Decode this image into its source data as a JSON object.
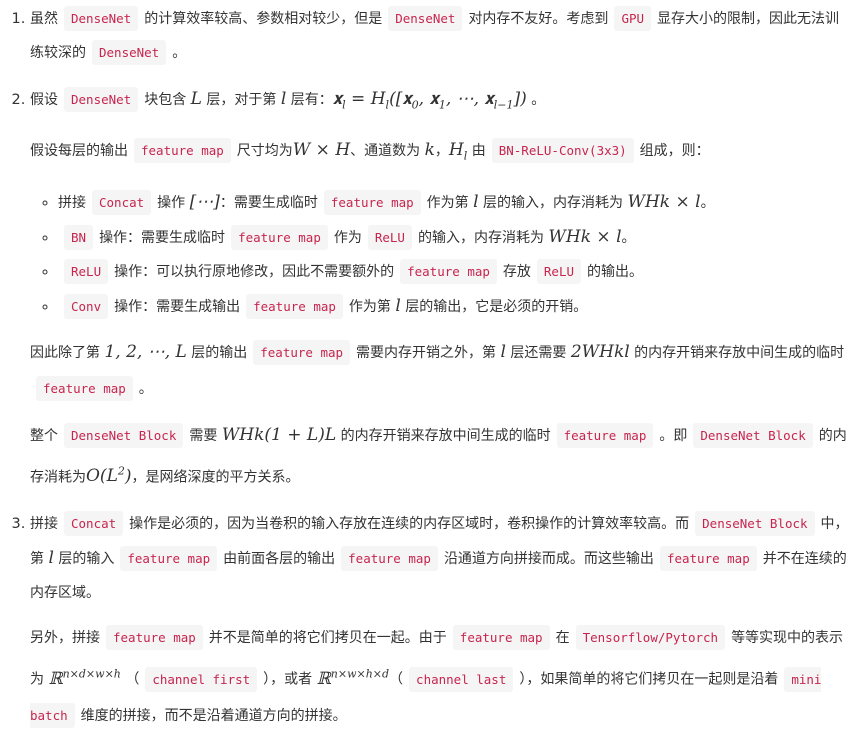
{
  "items": [
    {
      "paras": [
        [
          {
            "t": "虽然"
          },
          {
            "c": "DenseNet"
          },
          {
            "t": "的计算效率较高、参数相对较少，但是"
          },
          {
            "c": "DenseNet"
          },
          {
            "t": "对内存不友好。考虑到"
          },
          {
            "c": "GPU"
          },
          {
            "t": "显存大小的限制，因此无法训练较深的"
          },
          {
            "c": "DenseNet"
          },
          {
            "t": "。"
          }
        ]
      ],
      "bullets": [],
      "after": []
    },
    {
      "paras": [
        [
          {
            "t": "假设"
          },
          {
            "c": "DenseNet"
          },
          {
            "t": "块包含 "
          },
          {
            "m": "L"
          },
          {
            "t": " 层，对于第 "
          },
          {
            "m": "l"
          },
          {
            "t": " 层有："
          },
          {
            "m": "𝐱",
            "sub": "l"
          },
          {
            "m": " = H",
            "sub": "l"
          },
          {
            "m": "([𝐱",
            "sub": "0"
          },
          {
            "m": ", 𝐱",
            "sub": "1"
          },
          {
            "m": ", ⋯, 𝐱",
            "sub": "l−1"
          },
          {
            "m": "])"
          },
          {
            "t": " 。"
          }
        ],
        [
          {
            "t": "假设每层的输出"
          },
          {
            "c": "feature map"
          },
          {
            "t": "尺寸均为"
          },
          {
            "m": "W × H"
          },
          {
            "t": "、通道数为 "
          },
          {
            "m": "k"
          },
          {
            "t": "，"
          },
          {
            "m": "H",
            "sub": "l"
          },
          {
            "t": " 由"
          },
          {
            "c": "BN-ReLU-Conv(3x3)"
          },
          {
            "t": "组成，则："
          }
        ]
      ],
      "bullets": [
        [
          {
            "t": "拼接"
          },
          {
            "c": "Concat"
          },
          {
            "t": "操作 "
          },
          {
            "m": "[⋯]"
          },
          {
            "t": "：需要生成临时"
          },
          {
            "c": "feature map"
          },
          {
            "t": "作为第 "
          },
          {
            "m": "l"
          },
          {
            "t": " 层的输入，内存消耗为 "
          },
          {
            "m": "WHk × l"
          },
          {
            "t": "。"
          }
        ],
        [
          {
            "c": "BN"
          },
          {
            "t": "操作：需要生成临时"
          },
          {
            "c": "feature map"
          },
          {
            "t": "作为"
          },
          {
            "c": "ReLU"
          },
          {
            "t": "的输入，内存消耗为 "
          },
          {
            "m": "WHk × l"
          },
          {
            "t": "。"
          }
        ],
        [
          {
            "c": "ReLU"
          },
          {
            "t": "操作：可以执行原地修改，因此不需要额外的"
          },
          {
            "c": "feature map"
          },
          {
            "t": "存放"
          },
          {
            "c": "ReLU"
          },
          {
            "t": "的输出。"
          }
        ],
        [
          {
            "c": "Conv"
          },
          {
            "t": "操作：需要生成输出"
          },
          {
            "c": "feature map"
          },
          {
            "t": "作为第 "
          },
          {
            "m": "l"
          },
          {
            "t": " 层的输出，它是必须的开销。"
          }
        ]
      ],
      "after": [
        [
          {
            "t": "因此除了第 "
          },
          {
            "m": "1, 2, ⋯, L"
          },
          {
            "t": " 层的输出"
          },
          {
            "c": "feature map"
          },
          {
            "t": "需要内存开销之外，第 "
          },
          {
            "m": "l"
          },
          {
            "t": " 层还需要 "
          },
          {
            "m": "2WHkl"
          },
          {
            "t": " 的内存开销来存放中间生成的临时"
          },
          {
            "c": "feature map"
          },
          {
            "t": "。"
          }
        ],
        [
          {
            "t": "整个"
          },
          {
            "c": "DenseNet Block"
          },
          {
            "t": "需要 "
          },
          {
            "m": "WHk(1 + L)L"
          },
          {
            "t": " 的内存开销来存放中间生成的临时"
          },
          {
            "c": "feature map"
          },
          {
            "t": "。即"
          },
          {
            "c": "DenseNet Block"
          },
          {
            "t": "的内存消耗为"
          },
          {
            "m": "O(L",
            "sup": "2"
          },
          {
            "m": ")"
          },
          {
            "t": "，是网络深度的平方关系。"
          }
        ]
      ]
    },
    {
      "paras": [
        [
          {
            "t": "拼接"
          },
          {
            "c": "Concat"
          },
          {
            "t": "操作是必须的，因为当卷积的输入存放在连续的内存区域时，卷积操作的计算效率较高。而"
          },
          {
            "c": "DenseNet Block"
          },
          {
            "t": "中，第 "
          },
          {
            "m": "l"
          },
          {
            "t": " 层的输入"
          },
          {
            "c": "feature map"
          },
          {
            "t": "由前面各层的输出"
          },
          {
            "c": "feature map"
          },
          {
            "t": "沿通道方向拼接而成。而这些输出"
          },
          {
            "c": "feature map"
          },
          {
            "t": "并不在连续的内存区域。"
          }
        ],
        [
          {
            "t": "另外，拼接"
          },
          {
            "c": "feature map"
          },
          {
            "t": "并不是简单的将它们拷贝在一起。由于"
          },
          {
            "c": "feature map"
          },
          {
            "t": "在"
          },
          {
            "c": "Tensorflow/Pytorch"
          },
          {
            "t": "等等实现中的表示为 "
          },
          {
            "m": "ℝ",
            "sup": "n×d×w×h"
          },
          {
            "t": " （"
          },
          {
            "c": "channel first"
          },
          {
            "t": "），或者 "
          },
          {
            "m": "ℝ",
            "sup": "n×w×h×d"
          },
          {
            "t": "（"
          },
          {
            "c": "channel last"
          },
          {
            "t": "），如果简单的将它们拷贝在一起则是沿着"
          },
          {
            "c": "mini batch"
          },
          {
            "t": "维度的拼接，而不是沿着通道方向的拼接。"
          }
        ]
      ],
      "bullets": [],
      "after": []
    }
  ]
}
